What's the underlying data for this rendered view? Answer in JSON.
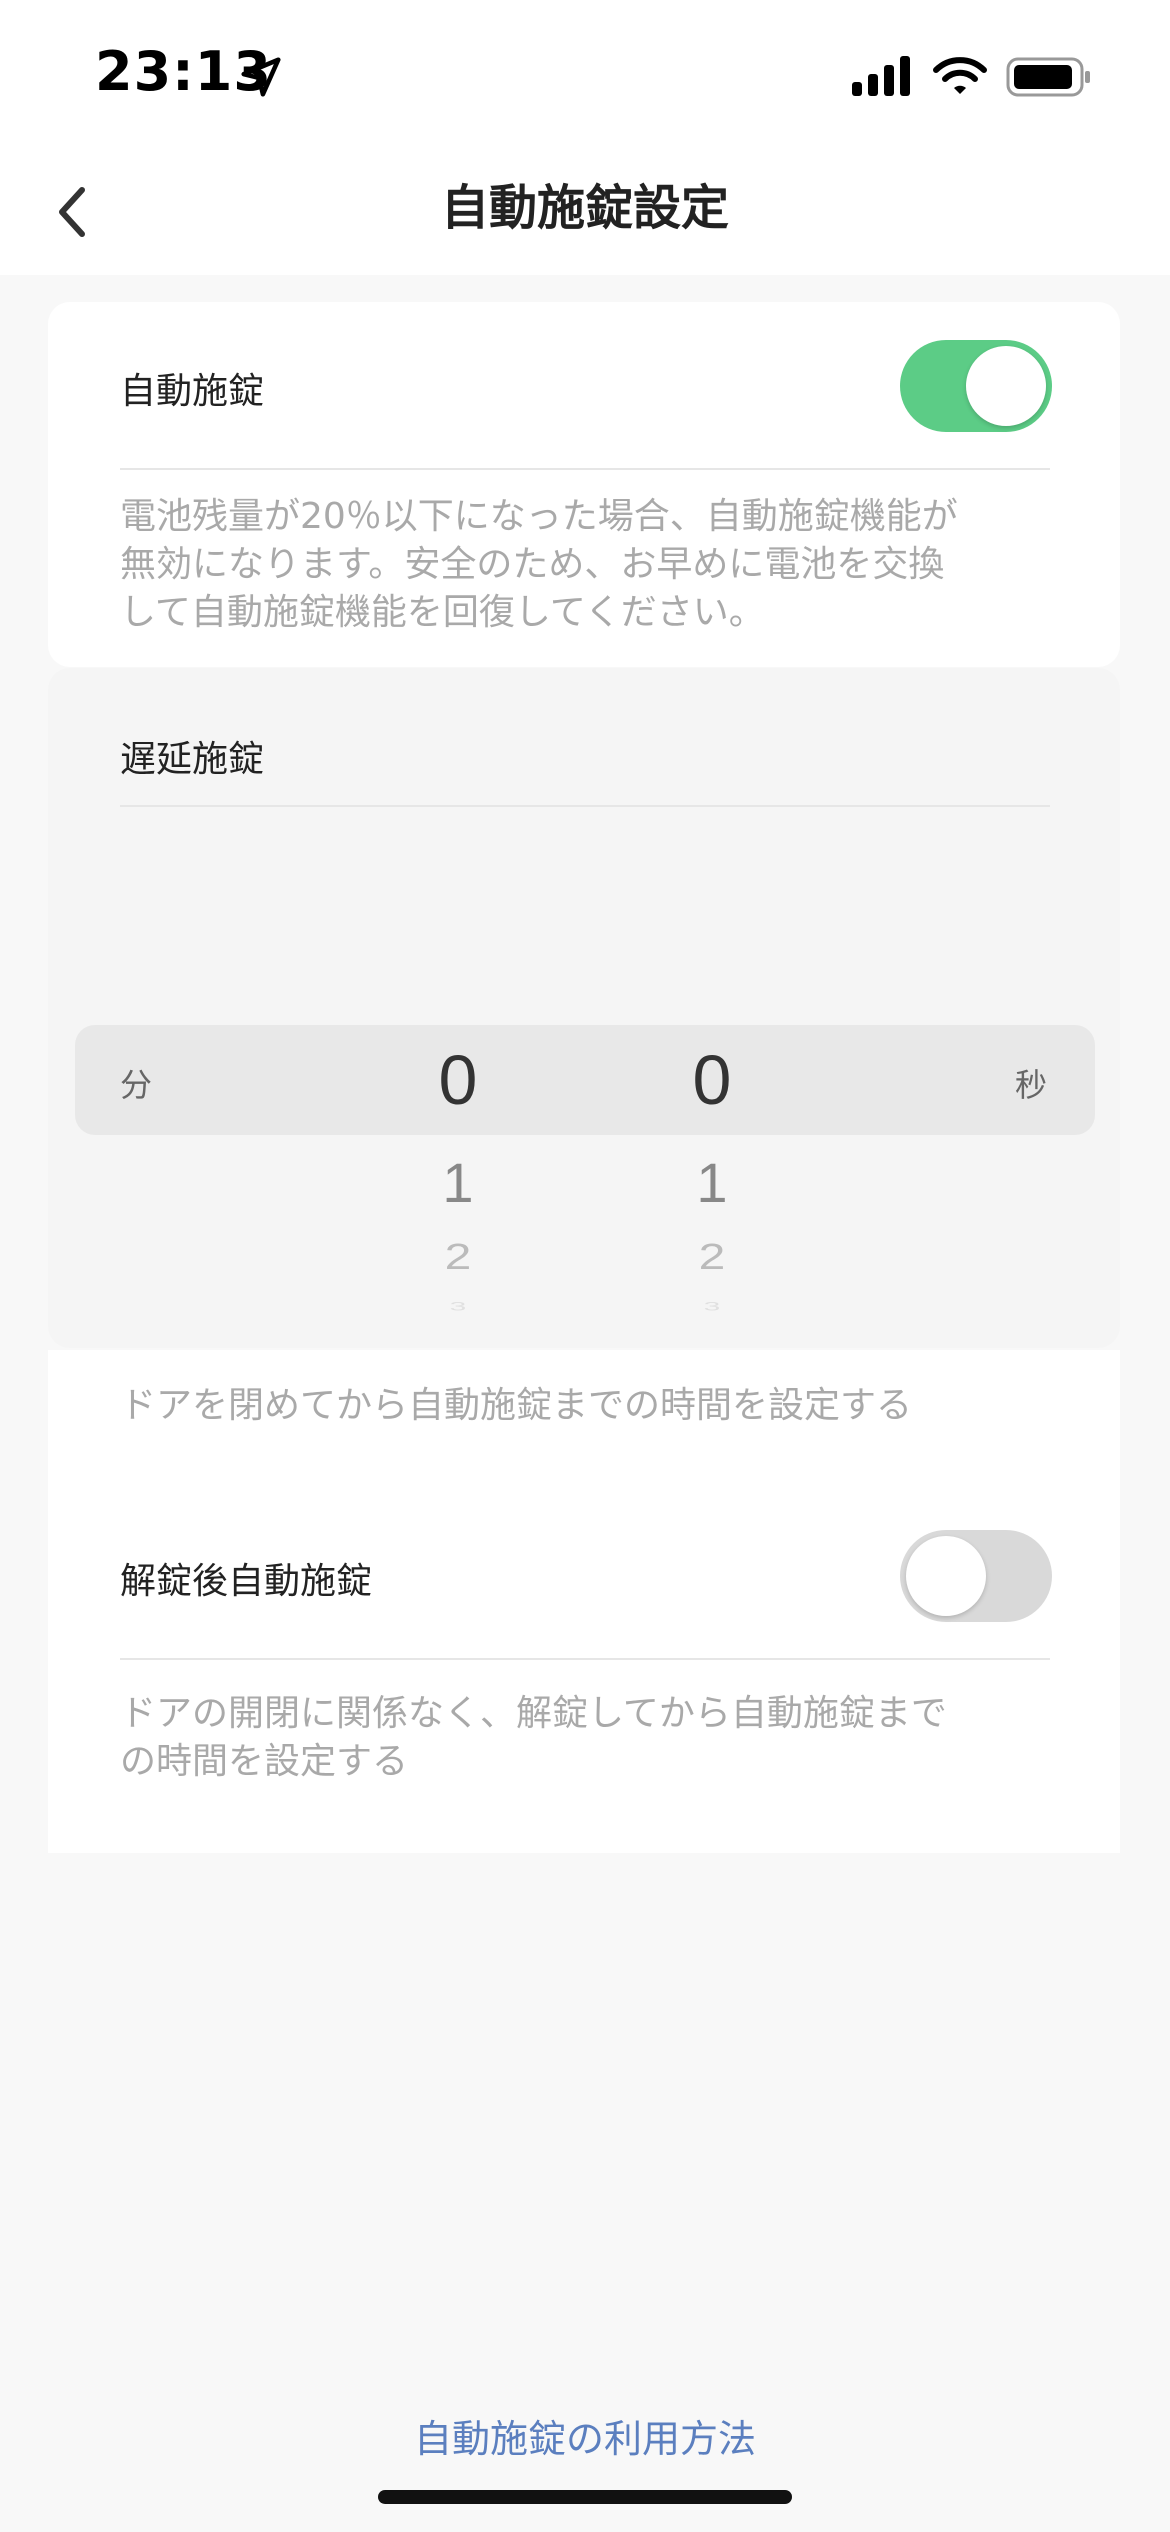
{
  "status_bar": {
    "time": "23:13"
  },
  "nav": {
    "title": "自動施錠設定"
  },
  "auto_lock": {
    "label": "自動施錠",
    "enabled": true,
    "note_lines": [
      "電池残量が20％以下になった場合、自動施錠機能が",
      "無効になります。安全のため、お早めに電池を交換",
      "して自動施錠機能を回復してください。"
    ]
  },
  "delay_lock": {
    "label": "遅延施錠",
    "picker": {
      "minute_unit": "分",
      "second_unit": "秒",
      "minutes_selected": "0",
      "seconds_selected": "0",
      "minutes_next": [
        "1",
        "2",
        "3"
      ],
      "seconds_next": [
        "1",
        "2",
        "3"
      ]
    },
    "note": "ドアを閉めてから自動施錠までの時間を設定する"
  },
  "unlock_auto_lock": {
    "label": "解錠後自動施錠",
    "enabled": false,
    "note_lines": [
      "ドアの開閉に関係なく、解錠してから自動施錠まで",
      "の時間を設定する"
    ]
  },
  "footer": {
    "help_link": "自動施錠の利用方法"
  },
  "colors": {
    "toggle_on": "#5ccc86",
    "toggle_off": "#d9d9d9",
    "link": "#5b7fbf"
  }
}
